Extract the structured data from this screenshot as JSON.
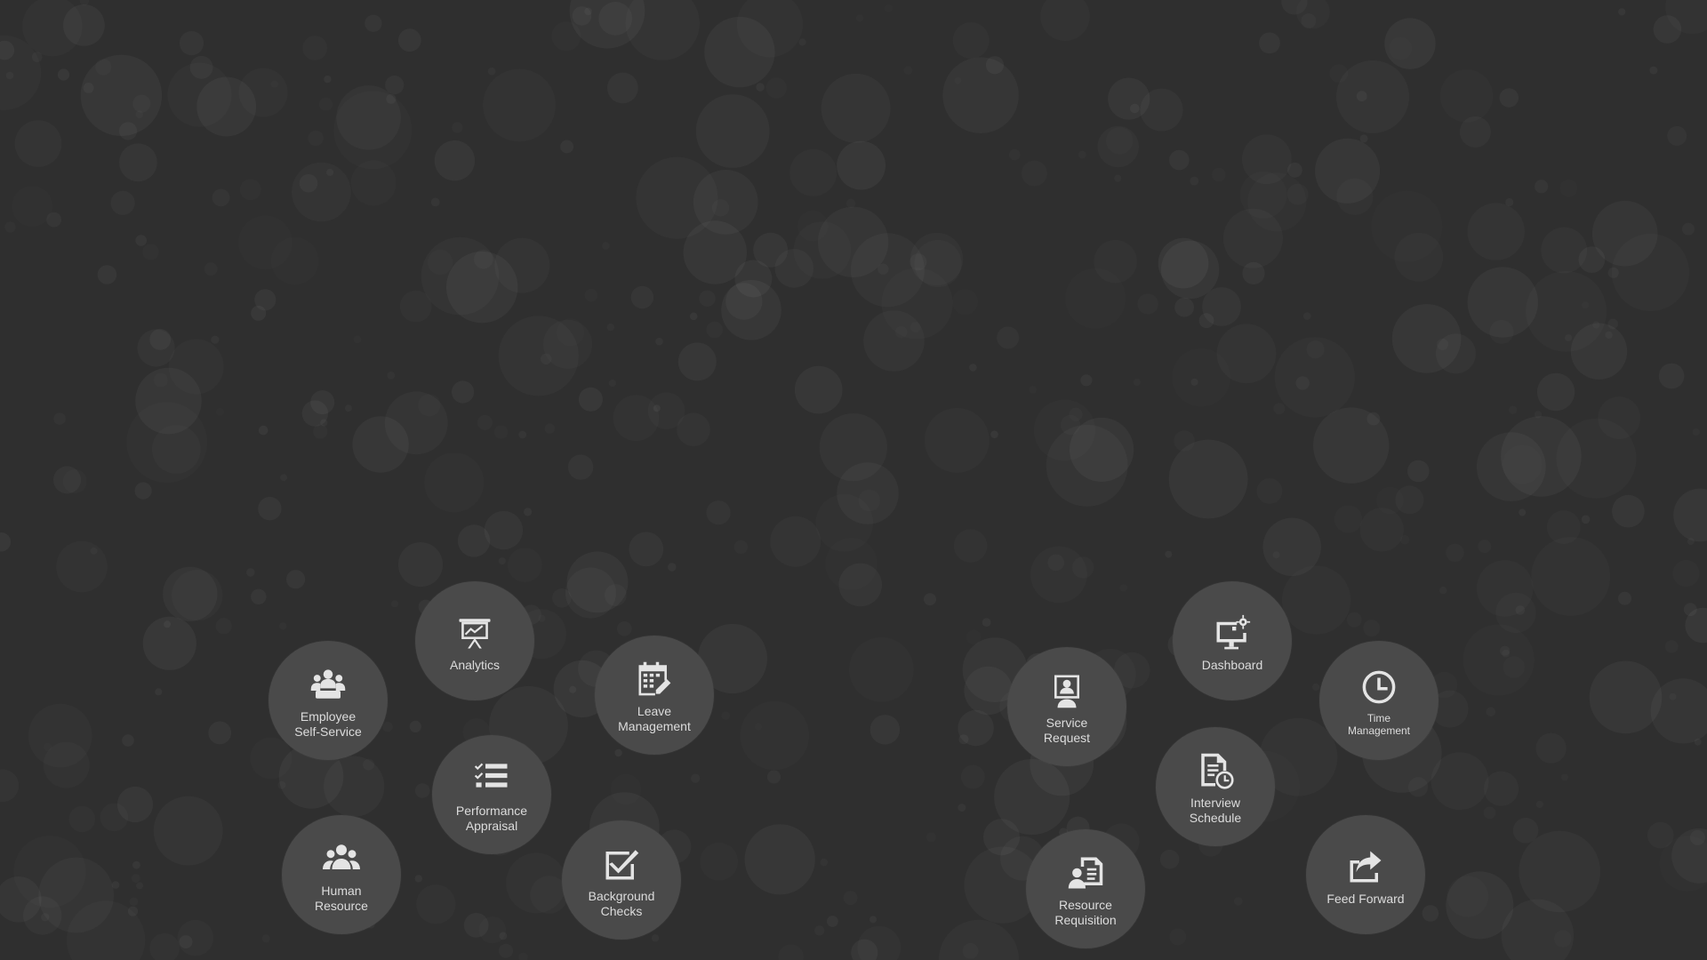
{
  "background": {
    "base_color": "#2f2f2f",
    "tile_color": "#4a4a4a",
    "text_color": "#dcdcdc",
    "icon_color": "#e4e4e4"
  },
  "modules": {
    "employee_self_service": {
      "label": "Employee\nSelf-Service",
      "icon": "employees-icon"
    },
    "analytics": {
      "label": "Analytics",
      "icon": "presentation-chart-icon"
    },
    "leave_management": {
      "label": "Leave\nManagement",
      "icon": "calendar-edit-icon"
    },
    "performance_appraisal": {
      "label": "Performance\nAppraisal",
      "icon": "checklist-icon"
    },
    "human_resource": {
      "label": "Human\nResource",
      "icon": "people-group-icon"
    },
    "background_checks": {
      "label": "Background\nChecks",
      "icon": "checkbox-icon"
    },
    "service_request": {
      "label": "Service\nRequest",
      "icon": "user-badge-icon"
    },
    "dashboard": {
      "label": "Dashboard",
      "icon": "monitor-gear-icon"
    },
    "time_management": {
      "label": "Time\nManagement",
      "icon": "clock-icon"
    },
    "interview_schedule": {
      "label": "Interview\nSchedule",
      "icon": "document-clock-icon"
    },
    "resource_requisition": {
      "label": "Resource\nRequisition",
      "icon": "user-document-icon"
    },
    "feed_forward": {
      "label": "Feed Forward",
      "icon": "share-arrow-icon"
    }
  }
}
